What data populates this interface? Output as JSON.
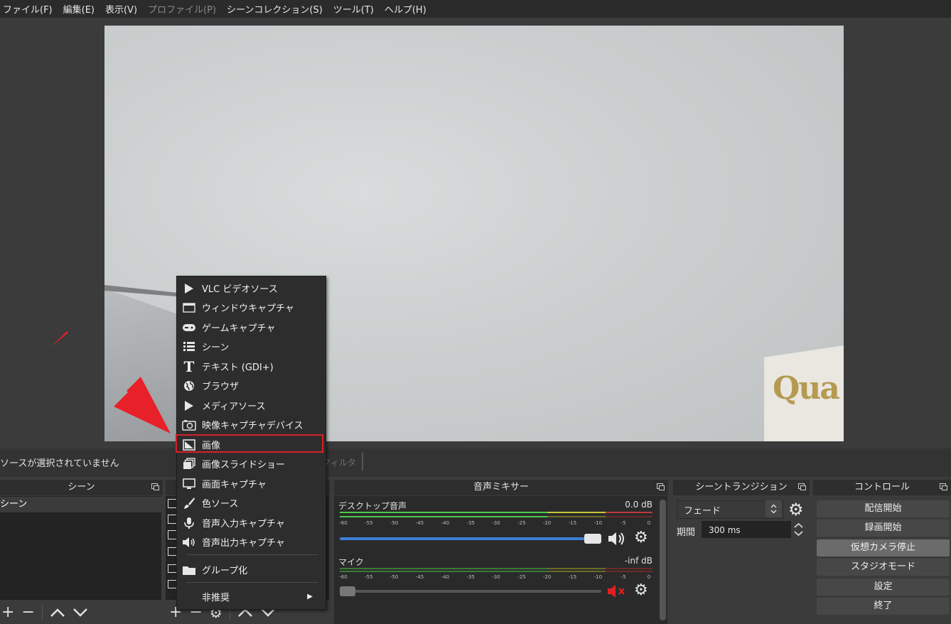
{
  "menubar": {
    "items": [
      {
        "label": "ファイル(F)",
        "enabled": true
      },
      {
        "label": "編集(E)",
        "enabled": true
      },
      {
        "label": "表示(V)",
        "enabled": true
      },
      {
        "label": "プロファイル(P)",
        "enabled": false
      },
      {
        "label": "シーンコレクション(S)",
        "enabled": true
      },
      {
        "label": "ツール(T)",
        "enabled": true
      },
      {
        "label": "ヘルプ(H)",
        "enabled": true
      }
    ]
  },
  "preview": {
    "sign_text": "Qua"
  },
  "statusbar": {
    "no_source_text": "ソースが選択されていません",
    "filter_label": "フィルタ"
  },
  "scenes": {
    "title": "シーン",
    "items": [
      "シーン"
    ]
  },
  "mixer": {
    "title": "音声ミキサー",
    "channels": [
      {
        "name": "デスクトップ音声",
        "db": "0.0 dB",
        "muted": false
      },
      {
        "name": "マイク",
        "db": "-inf dB",
        "muted": true
      }
    ],
    "ticks": [
      "-60",
      "-55",
      "-50",
      "-45",
      "-40",
      "-35",
      "-30",
      "-25",
      "-20",
      "-15",
      "-10",
      "-5",
      "0"
    ]
  },
  "transitions": {
    "title": "シーントランジション",
    "selected": "フェード",
    "duration_label": "期間",
    "duration_value": "300 ms"
  },
  "controls": {
    "title": "コントロール",
    "buttons": [
      {
        "label": "配信開始",
        "active": false
      },
      {
        "label": "録画開始",
        "active": false
      },
      {
        "label": "仮想カメラ停止",
        "active": true
      },
      {
        "label": "スタジオモード",
        "active": false
      },
      {
        "label": "設定",
        "active": false
      },
      {
        "label": "終了",
        "active": false
      }
    ]
  },
  "context_menu": {
    "items": [
      {
        "label": "VLC ビデオソース",
        "icon": "play-icon"
      },
      {
        "label": "ウィンドウキャプチャ",
        "icon": "window-icon"
      },
      {
        "label": "ゲームキャプチャ",
        "icon": "gamepad-icon"
      },
      {
        "label": "シーン",
        "icon": "list-icon"
      },
      {
        "label": "テキスト (GDI+)",
        "icon": "text-icon"
      },
      {
        "label": "ブラウザ",
        "icon": "globe-icon"
      },
      {
        "label": "メディアソース",
        "icon": "play-icon"
      },
      {
        "label": "映像キャプチャデバイス",
        "icon": "camera-icon"
      },
      {
        "label": "画像",
        "icon": "image-icon",
        "highlighted": true
      },
      {
        "label": "画像スライドショー",
        "icon": "slideshow-icon"
      },
      {
        "label": "画面キャプチャ",
        "icon": "monitor-icon"
      },
      {
        "label": "色ソース",
        "icon": "brush-icon"
      },
      {
        "label": "音声入力キャプチャ",
        "icon": "microphone-icon"
      },
      {
        "label": "音声出力キャプチャ",
        "icon": "speaker-icon"
      }
    ],
    "group_label": "グループ化",
    "deprecated_label": "非推奨"
  },
  "colors": {
    "highlight_border": "#d52027",
    "arrow": "#e8202a",
    "slider_blue": "#3d7fd8",
    "mute_red": "#e02020"
  }
}
